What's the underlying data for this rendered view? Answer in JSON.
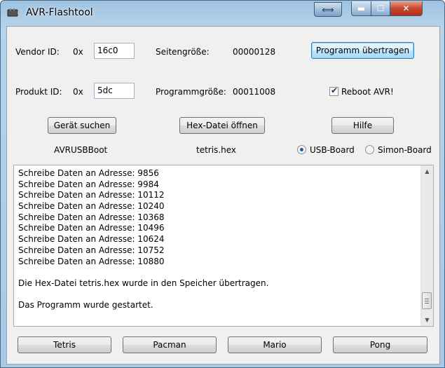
{
  "window": {
    "title": "AVR-Flashtool"
  },
  "titlebar_buttons": {
    "resize": "⟺",
    "minimize": "▬",
    "maximize": "☐",
    "close": "✕"
  },
  "vendor": {
    "label": "Vendor ID:",
    "prefix": "0x",
    "value": "16c0"
  },
  "produkt": {
    "label": "Produkt ID:",
    "prefix": "0x",
    "value": "5dc"
  },
  "seitengroesse": {
    "label": "Seitengröße:",
    "value": "00000128"
  },
  "programmgroesse": {
    "label": "Programmgröße:",
    "value": "00011008"
  },
  "buttons": {
    "programm_uebertragen": "Programm übertragen",
    "geraet_suchen": "Gerät suchen",
    "hex_oeffnen": "Hex-Datei öffnen",
    "hilfe": "Hilfe"
  },
  "reboot": {
    "label": "Reboot AVR!",
    "checked": true
  },
  "device_name": "AVRUSBBoot",
  "file_name": "tetris.hex",
  "board": {
    "usb_label": "USB-Board",
    "simon_label": "Simon-Board",
    "selected": "USB-Board"
  },
  "log": [
    "Schreibe Daten an Adresse: 9856",
    "Schreibe Daten an Adresse: 9984",
    "Schreibe Daten an Adresse: 10112",
    "Schreibe Daten an Adresse: 10240",
    "Schreibe Daten an Adresse: 10368",
    "Schreibe Daten an Adresse: 10496",
    "Schreibe Daten an Adresse: 10624",
    "Schreibe Daten an Adresse: 10752",
    "Schreibe Daten an Adresse: 10880",
    "",
    "Die Hex-Datei tetris.hex wurde in den Speicher übertragen.",
    "",
    "Das Programm wurde gestartet."
  ],
  "games": {
    "tetris": "Tetris",
    "pacman": "Pacman",
    "mario": "Mario",
    "pong": "Pong"
  },
  "colors": {
    "accent": "#1e5ea8",
    "close": "#c9452b",
    "frame": "#a8c8e3"
  }
}
